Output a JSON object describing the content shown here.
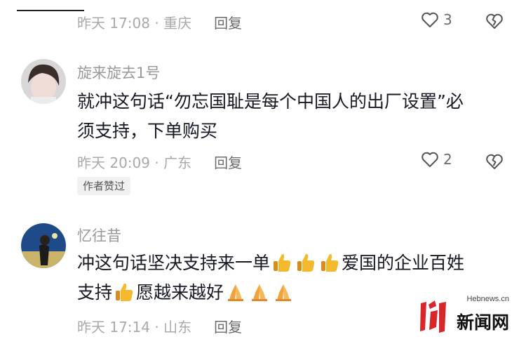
{
  "comments": [
    {
      "meta": "昨天 17:08 · 重庆",
      "reply_label": "回复",
      "likes": "3"
    },
    {
      "username": "旋来旋去1号",
      "text_line1": "就冲这句话“勿忘国耻是每个中国人的出厂设置”必",
      "text_line2": "须支持，下单购买",
      "meta": "昨天 20:09 · 广东",
      "reply_label": "回复",
      "likes": "2",
      "author_tag": "作者赞过"
    },
    {
      "username": "忆往昔",
      "text_line1_a": "冲这句话坚决支持来一单",
      "text_line1_b": "爱国的企业百姓",
      "text_line2_a": "支持",
      "text_line2_b": "愿越来越好",
      "meta": "昨天 17:14 · 山东",
      "reply_label": "回复"
    }
  ],
  "watermark": {
    "site_url": "Hebnews.cn",
    "site_name": "新闻网",
    "logo_text": "河北"
  },
  "colors": {
    "meta_gray": "#a9a9a9",
    "text_dark": "#161823",
    "logo_red": "#d9262b",
    "thumb_yellow": "#f5b92e",
    "hands_orange": "#f2a23a"
  },
  "icons": {
    "like": "heart-outline-icon",
    "dislike": "broken-heart-icon",
    "thumbs": "thumbs-up-emoji",
    "pray": "folded-hands-emoji"
  }
}
